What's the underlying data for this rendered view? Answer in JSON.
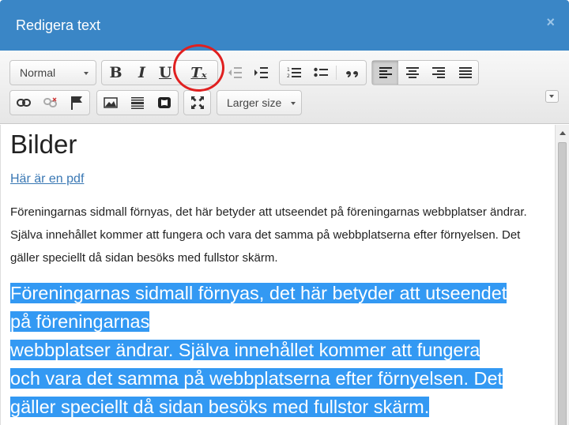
{
  "dialog": {
    "title": "Redigera text",
    "close_glyph": "×"
  },
  "toolbar": {
    "format_value": "Normal",
    "bold_glyph": "B",
    "italic_glyph": "I",
    "underline_glyph": "U",
    "remove_format_glyph": "Tₓ",
    "size_value": "Larger size"
  },
  "content": {
    "heading": "Bilder",
    "link": "Här är en pdf",
    "paragraph": "Föreningarnas sidmall förnyas, det här betyder att utseendet på föreningarnas webbplatser ändrar. Själva innehållet kommer att fungera och vara det samma på webbplatserna efter förnyelsen. Det gäller speciellt då sidan besöks med fullstor skärm.",
    "selected_lines": [
      "Föreningarnas sidmall förnyas, det här betyder att utseendet",
      "på föreningarnas",
      "webbplatser ändrar. Själva innehållet kommer att fungera",
      "och vara det samma på webbplatserna efter förnyelsen. Det",
      "gäller speciellt då sidan besöks med fullstor skärm."
    ]
  },
  "colors": {
    "header": "#3a86c6",
    "selection": "#3399f3",
    "highlight_circle": "#e02020",
    "link": "#3a78b4"
  }
}
